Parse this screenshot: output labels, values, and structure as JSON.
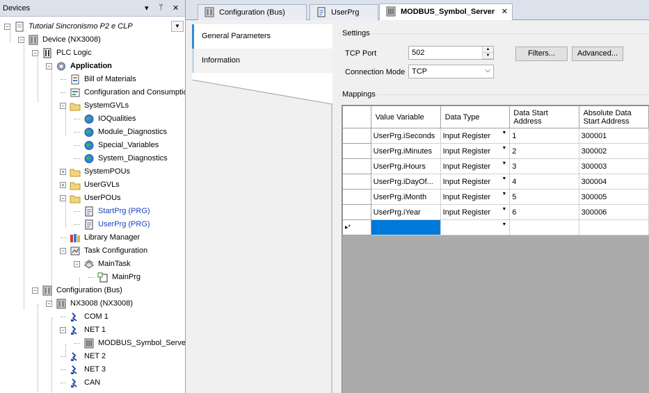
{
  "devices_panel": {
    "title": "Devices",
    "tree": [
      {
        "label": "Tutorial Sincronismo P2 e CLP",
        "icon": "project-icon",
        "italic": true
      },
      {
        "label": "Device (NX3008)",
        "icon": "device-icon"
      },
      {
        "label": "PLC Logic",
        "icon": "plc-logic-icon"
      },
      {
        "label": "Application",
        "icon": "gear-icon",
        "bold": true
      },
      {
        "label": "Bill of Materials",
        "icon": "document-icon"
      },
      {
        "label": "Configuration and Consumption",
        "icon": "config-icon"
      },
      {
        "label": "SystemGVLs",
        "icon": "folder-icon"
      },
      {
        "label": "IOQualities",
        "icon": "globe-icon"
      },
      {
        "label": "Module_Diagnostics",
        "icon": "globe-icon"
      },
      {
        "label": "Special_Variables",
        "icon": "globe-icon"
      },
      {
        "label": "System_Diagnostics",
        "icon": "globe-icon"
      },
      {
        "label": "SystemPOUs",
        "icon": "folder-icon"
      },
      {
        "label": "UserGVLs",
        "icon": "folder-icon"
      },
      {
        "label": "UserPOUs",
        "icon": "folder-icon"
      },
      {
        "label": "StartPrg (PRG)",
        "icon": "program-icon",
        "link": true
      },
      {
        "label": "UserPrg (PRG)",
        "icon": "program-icon",
        "link": true
      },
      {
        "label": "Library Manager",
        "icon": "library-icon"
      },
      {
        "label": "Task Configuration",
        "icon": "task-config-icon"
      },
      {
        "label": "MainTask",
        "icon": "task-icon"
      },
      {
        "label": "MainPrg",
        "icon": "program-call-icon"
      },
      {
        "label": "Configuration (Bus)",
        "icon": "bus-icon"
      },
      {
        "label": "NX3008 (NX3008)",
        "icon": "device-icon"
      },
      {
        "label": "COM 1",
        "icon": "port-icon"
      },
      {
        "label": "NET 1",
        "icon": "port-icon"
      },
      {
        "label": "MODBUS_Symbol_Server",
        "icon": "modbus-icon"
      },
      {
        "label": "NET 2",
        "icon": "port-icon"
      },
      {
        "label": "NET 3",
        "icon": "port-icon"
      },
      {
        "label": "CAN",
        "icon": "port-icon"
      }
    ]
  },
  "editor_tabs": [
    {
      "label": "Configuration (Bus)",
      "icon": "bus-icon"
    },
    {
      "label": "UserPrg",
      "icon": "program-icon"
    },
    {
      "label": "MODBUS_Symbol_Server",
      "icon": "modbus-icon",
      "active": true
    }
  ],
  "side_tabs": [
    "General Parameters",
    "Information"
  ],
  "settings": {
    "group_title": "Settings",
    "tcp_port_label": "TCP Port",
    "tcp_port_value": "502",
    "connection_mode_label": "Connection Mode",
    "connection_mode_value": "TCP",
    "filters_button": "Filters...",
    "advanced_button": "Advanced..."
  },
  "mappings": {
    "group_title": "Mappings",
    "columns": [
      "Value Variable",
      "Data Type",
      "Data Start Address",
      "Absolute Data Start Address"
    ],
    "rows": [
      {
        "variable": "UserPrg.iSeconds",
        "type": "Input Register",
        "start": "1",
        "absolute": "300001"
      },
      {
        "variable": "UserPrg.iMinutes",
        "type": "Input Register",
        "start": "2",
        "absolute": "300002"
      },
      {
        "variable": "UserPrg.iHours",
        "type": "Input Register",
        "start": "3",
        "absolute": "300003"
      },
      {
        "variable": "UserPrg.iDayOf...",
        "type": "Input Register",
        "start": "4",
        "absolute": "300004"
      },
      {
        "variable": "UserPrg.iMonth",
        "type": "Input Register",
        "start": "5",
        "absolute": "300005"
      },
      {
        "variable": "UserPrg.iYear",
        "type": "Input Register",
        "start": "6",
        "absolute": "300006"
      }
    ],
    "new_row_marker": "▸*"
  },
  "colors": {
    "accent": "#2e8cd6",
    "selection": "#0078d7",
    "link": "#1a3fbf"
  }
}
